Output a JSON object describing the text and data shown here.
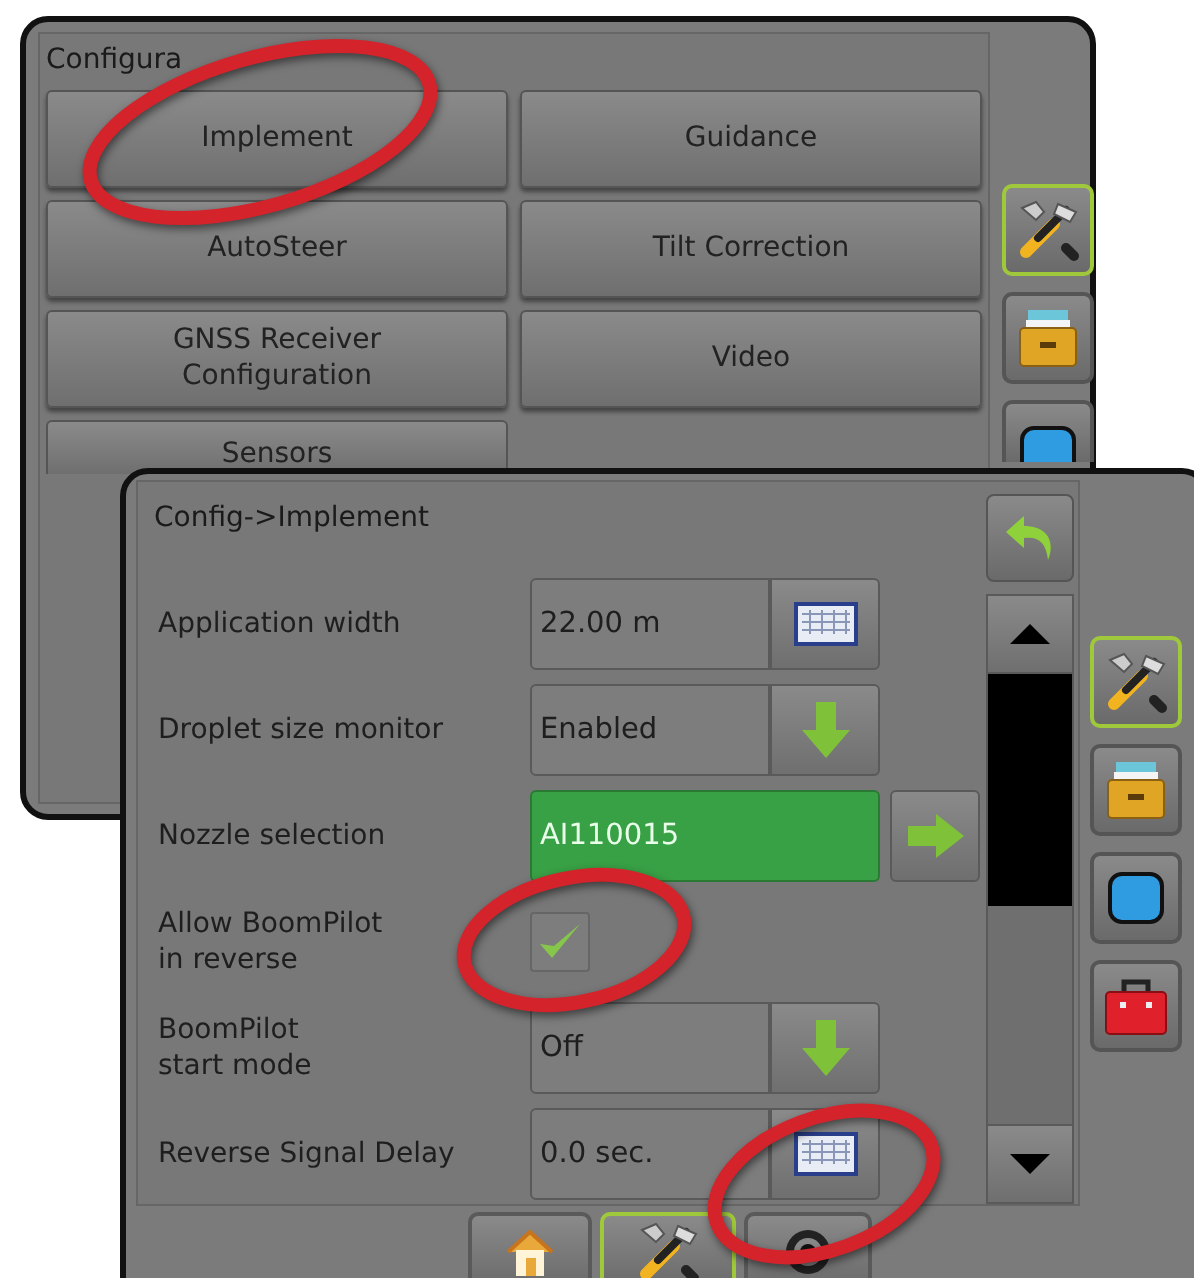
{
  "back_window": {
    "title": "Configura",
    "buttons": [
      {
        "label": "Implement"
      },
      {
        "label": "Guidance"
      },
      {
        "label": "AutoSteer"
      },
      {
        "label": "Tilt Correction"
      },
      {
        "label": "GNSS Receiver\nConfiguration"
      },
      {
        "label": "Video"
      },
      {
        "label": "Sensors"
      }
    ],
    "side_tabs": [
      {
        "kind": "tools",
        "selected": true
      },
      {
        "kind": "files",
        "selected": false
      },
      {
        "kind": "display",
        "selected": false
      }
    ]
  },
  "front_window": {
    "title": "Config->Implement",
    "settings": [
      {
        "kind": "field",
        "label": "Application width",
        "value": "22.00 m"
      },
      {
        "kind": "dropdown",
        "label": "Droplet size monitor",
        "value": "Enabled"
      },
      {
        "kind": "selector",
        "label": "Nozzle selection",
        "value": "AI110015"
      },
      {
        "kind": "checkbox",
        "label": "Allow BoomPilot\nin reverse",
        "checked": true
      },
      {
        "kind": "dropdown",
        "label": "BoomPilot\nstart mode",
        "value": "Off"
      },
      {
        "kind": "field",
        "label": "Reverse Signal Delay",
        "value": "0.0 sec."
      }
    ],
    "side_tabs": [
      {
        "kind": "tools",
        "selected": true
      },
      {
        "kind": "files",
        "selected": false
      },
      {
        "kind": "display",
        "selected": false
      },
      {
        "kind": "toolbox",
        "selected": false
      }
    ],
    "bottom_tabs": [
      {
        "kind": "home",
        "selected": false
      },
      {
        "kind": "tools",
        "selected": true
      },
      {
        "kind": "camera",
        "selected": false
      }
    ]
  },
  "highlights": [
    {
      "kind": "ellipse"
    },
    {
      "kind": "ellipse"
    },
    {
      "kind": "ellipse"
    }
  ]
}
